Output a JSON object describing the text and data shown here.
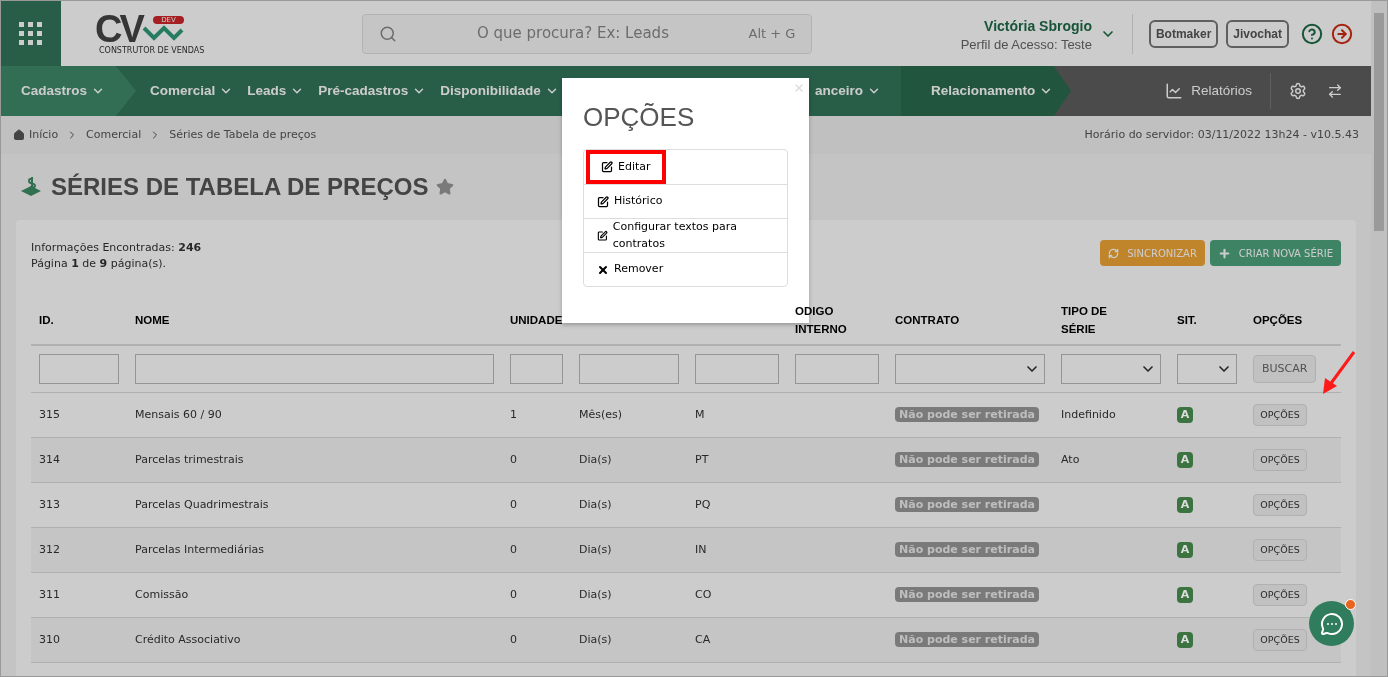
{
  "logo": {
    "mark": "CV",
    "badge": "DEV",
    "tagline": "CONSTRUTOR DE VENDAS"
  },
  "search": {
    "placeholder": "O que procura? Ex: Leads",
    "shortcut": "Alt + G"
  },
  "user": {
    "name": "Victória Sbrogio",
    "profile": "Perfil de Acesso: Teste"
  },
  "top_buttons": [
    "Botmaker",
    "Jivochat"
  ],
  "nav": {
    "items": [
      {
        "label": "Cadastros"
      },
      {
        "label": "Comercial"
      },
      {
        "label": "Leads"
      },
      {
        "label": "Pré-cadastros"
      },
      {
        "label": "Disponibilidade"
      }
    ],
    "after_modal": [
      {
        "label": "anceiro"
      },
      {
        "label": "Relacionamento"
      }
    ],
    "reports": "Relatórios"
  },
  "breadcrumb": [
    "Início",
    "Comercial",
    "Séries de Tabela de preços"
  ],
  "server_time": "Horário do servidor: 03/11/2022 13h24 - v10.5.43",
  "page_title": "SÉRIES DE TABELA DE PREÇOS",
  "info": {
    "found": "Informações Encontradas: **246**",
    "page": "Página **1** de **9** página(s)."
  },
  "actions": [
    {
      "label": "SINCRONIZAR",
      "kind": "sync"
    },
    {
      "label": "CRIAR NOVA SÉRIE",
      "kind": "create"
    }
  ],
  "table": {
    "columns": [
      {
        "label": "ID.",
        "kind": "text"
      },
      {
        "label": "NOME",
        "kind": "text"
      },
      {
        "label": "UNIDADE",
        "kind": "text"
      },
      {
        "kind": "text"
      },
      {
        "kind": "text"
      },
      {
        "label": "ODIGO INTERNO",
        "kind": "text"
      },
      {
        "label": "CONTRATO",
        "kind": "select"
      },
      {
        "label": "TIPO DE SÉRIE",
        "kind": "select"
      },
      {
        "label": "SIT.",
        "kind": "select"
      },
      {
        "label": "OPÇÕES",
        "kind": "button"
      }
    ],
    "search_button": "BUSCAR",
    "rows": [
      {
        "id": "315",
        "name": "Mensais 60 / 90",
        "unit": "1",
        "period": "Mês(es)",
        "code": "M",
        "contract": "Não pode ser retirada",
        "type": "Indefinido",
        "status": "A",
        "color": "#3b7440",
        "options": "OPÇÕES"
      },
      {
        "id": "314",
        "name": "Parcelas trimestrais",
        "unit": "0",
        "period": "Dia(s)",
        "code": "PT",
        "contract": "Não pode ser retirada",
        "type": "Ato",
        "status": "A",
        "color": "#3b7440",
        "options": "OPÇÕES"
      },
      {
        "id": "313",
        "name": "Parcelas Quadrimestrais",
        "unit": "0",
        "period": "Dia(s)",
        "code": "PQ",
        "contract": "Não pode ser retirada",
        "status": "A",
        "color": "#3b7440",
        "options": "OPÇÕES"
      },
      {
        "id": "312",
        "name": "Parcelas Intermediárias",
        "unit": "0",
        "period": "Dia(s)",
        "code": "IN",
        "contract": "Não pode ser retirada",
        "status": "A",
        "color": "#3b7440",
        "options": "OPÇÕES"
      },
      {
        "id": "311",
        "name": "Comissão",
        "unit": "0",
        "period": "Dia(s)",
        "code": "CO",
        "contract": "Não pode ser retirada",
        "status": "A",
        "color": "#3b7440",
        "options": "OPÇÕES"
      },
      {
        "id": "310",
        "name": "Crédito Associativo",
        "unit": "0",
        "period": "Dia(s)",
        "code": "CA",
        "contract": "Não pode ser retirada",
        "status": "A",
        "color": "#3b7440",
        "options": "OPÇÕES"
      }
    ]
  },
  "modal": {
    "title": "OPÇÕES",
    "items": [
      {
        "label": "Editar",
        "kind": "edit",
        "highlighted": true
      },
      {
        "label": "Histórico",
        "kind": "edit",
        "highlighted": false
      },
      {
        "label": "Configurar textos para contratos",
        "kind": "edit",
        "highlighted": false
      },
      {
        "label": "Remover",
        "kind": "remove",
        "highlighted": false
      }
    ]
  }
}
